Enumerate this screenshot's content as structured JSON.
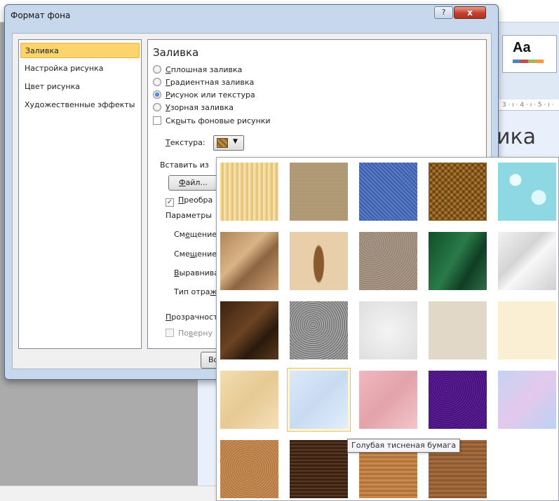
{
  "dialog": {
    "title": "Формат фона",
    "help_glyph": "?",
    "close_glyph": "x",
    "close_button_label": "Во"
  },
  "nav": [
    {
      "label": "Заливка",
      "selected": true
    },
    {
      "label": "Настройка рисунка",
      "selected": false
    },
    {
      "label": "Цвет рисунка",
      "selected": false
    },
    {
      "label": "Художественные эффекты",
      "selected": false
    }
  ],
  "fill": {
    "section_title": "Заливка",
    "options": [
      {
        "ul": "С",
        "rest": "плошная заливка",
        "checked": false
      },
      {
        "ul": "Г",
        "rest": "радиентная заливка",
        "checked": false
      },
      {
        "ul": "Р",
        "rest": "исунок или текстура",
        "checked": true
      },
      {
        "ul": "У",
        "rest": "зорная заливка",
        "checked": false
      }
    ],
    "hide_bg": {
      "pre": "Ск",
      "ul": "р",
      "rest": "ыть фоновые рисунки",
      "checked": false
    },
    "texture_label": {
      "ul": "Т",
      "rest": "екстура:"
    },
    "insert_from": "Вставить из",
    "file_button": {
      "ul": "Ф",
      "rest": "айл..."
    },
    "tile_check": {
      "ul": "П",
      "rest": "реобра",
      "checked": true
    },
    "params_label": "Параметры",
    "offset_x": {
      "pre": "См",
      "ul": "е",
      "rest": "щение"
    },
    "offset_y": {
      "pre": "Сме",
      "ul": "щ",
      "rest": "ение"
    },
    "align": {
      "ul": "В",
      "rest": "ыравнива"
    },
    "mirror": {
      "pre": "Тип отра",
      "ul": "ж",
      "rest": ""
    },
    "transparency": {
      "ul": "П",
      "rest": "розрачност"
    },
    "rotate": {
      "pre": "По",
      "ul": "в",
      "rest": "ерну",
      "disabled": true
    }
  },
  "background": {
    "theme_label": "Aa",
    "ruler_text": "3 · ı · 4 · ı · 5 · ı ·",
    "slide_title_fragment": "ика"
  },
  "gallery": {
    "hovered_name": "Голубая тисненая бумага",
    "tiles": [
      "papyrus",
      "canvas",
      "denim",
      "woven-mat",
      "water-droplets",
      "paper-bag",
      "fish-fossil",
      "sand",
      "green-marble",
      "white-marble",
      "brown-marble",
      "granite",
      "newsprint",
      "recycled-paper",
      "parchment",
      "stationery",
      "blue-tissue-paper",
      "pink-tissue-paper",
      "purple-mesh",
      "bouquet",
      "cork",
      "walnut",
      "oak",
      "medium-wood"
    ]
  }
}
